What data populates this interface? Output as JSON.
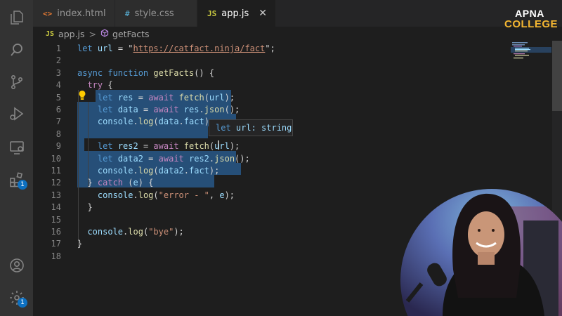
{
  "tabs": [
    {
      "icon": "<>",
      "label": "index.html",
      "active": false
    },
    {
      "icon": "#",
      "label": "style.css",
      "active": false
    },
    {
      "icon": "JS",
      "label": "app.js",
      "active": true,
      "close": "✕"
    }
  ],
  "breadcrumb": {
    "file_icon": "JS",
    "file": "app.js",
    "separator": ">",
    "symbol": "getFacts"
  },
  "activity_bar": {
    "extensions_badge": "1",
    "settings_badge": "1"
  },
  "hover": {
    "kw": "let",
    "text": " url: string"
  },
  "logo": {
    "line1": "APNA",
    "line2": "COLLEGE"
  },
  "code_lines": [
    {
      "num": "1",
      "tokens": [
        [
          "kw",
          "let"
        ],
        [
          "pl",
          " "
        ],
        [
          "var",
          "url"
        ],
        [
          "pl",
          " = \""
        ],
        [
          "url",
          "https://catfact.ninja/fact"
        ],
        [
          "pl",
          "\";"
        ]
      ]
    },
    {
      "num": "2",
      "tokens": []
    },
    {
      "num": "3",
      "tokens": [
        [
          "kw",
          "async"
        ],
        [
          "pl",
          " "
        ],
        [
          "kw",
          "function"
        ],
        [
          "pl",
          " "
        ],
        [
          "fn",
          "getFacts"
        ],
        [
          "pl",
          "() {"
        ]
      ]
    },
    {
      "num": "4",
      "tokens": [
        [
          "pl",
          "  "
        ],
        [
          "kw2",
          "try"
        ],
        [
          "pl",
          " {"
        ]
      ]
    },
    {
      "num": "5",
      "tokens": [
        [
          "pl",
          "    "
        ],
        [
          "kw",
          "let"
        ],
        [
          "pl",
          " "
        ],
        [
          "var",
          "res"
        ],
        [
          "pl",
          " = "
        ],
        [
          "kw2",
          "await"
        ],
        [
          "pl",
          " "
        ],
        [
          "fn",
          "fetch"
        ],
        [
          "pl",
          "("
        ],
        [
          "var",
          "url"
        ],
        [
          "pl",
          ");"
        ]
      ]
    },
    {
      "num": "6",
      "tokens": [
        [
          "pl",
          "    "
        ],
        [
          "kw",
          "let"
        ],
        [
          "pl",
          " "
        ],
        [
          "var",
          "data"
        ],
        [
          "pl",
          " = "
        ],
        [
          "kw2",
          "await"
        ],
        [
          "pl",
          " "
        ],
        [
          "var",
          "res"
        ],
        [
          "pl",
          "."
        ],
        [
          "fn",
          "json"
        ],
        [
          "pl",
          "();"
        ]
      ]
    },
    {
      "num": "7",
      "tokens": [
        [
          "pl",
          "    "
        ],
        [
          "var",
          "console"
        ],
        [
          "pl",
          "."
        ],
        [
          "fn",
          "log"
        ],
        [
          "pl",
          "("
        ],
        [
          "var",
          "data"
        ],
        [
          "pl",
          "."
        ],
        [
          "var",
          "fact"
        ],
        [
          "pl",
          ");"
        ]
      ]
    },
    {
      "num": "8",
      "tokens": []
    },
    {
      "num": "9",
      "tokens": [
        [
          "pl",
          "    "
        ],
        [
          "kw",
          "let"
        ],
        [
          "pl",
          " "
        ],
        [
          "var",
          "res2"
        ],
        [
          "pl",
          " = "
        ],
        [
          "kw2",
          "await"
        ],
        [
          "pl",
          " "
        ],
        [
          "fn",
          "fetch"
        ],
        [
          "pl",
          "("
        ],
        [
          "var",
          "url"
        ],
        [
          "pl",
          ");"
        ]
      ]
    },
    {
      "num": "10",
      "tokens": [
        [
          "pl",
          "    "
        ],
        [
          "kw",
          "let"
        ],
        [
          "pl",
          " "
        ],
        [
          "var",
          "data2"
        ],
        [
          "pl",
          " = "
        ],
        [
          "kw2",
          "await"
        ],
        [
          "pl",
          " "
        ],
        [
          "var",
          "res2"
        ],
        [
          "pl",
          "."
        ],
        [
          "fn",
          "json"
        ],
        [
          "pl",
          "();"
        ]
      ]
    },
    {
      "num": "11",
      "tokens": [
        [
          "pl",
          "    "
        ],
        [
          "var",
          "console"
        ],
        [
          "pl",
          "."
        ],
        [
          "fn",
          "log"
        ],
        [
          "pl",
          "("
        ],
        [
          "var",
          "data2"
        ],
        [
          "pl",
          "."
        ],
        [
          "var",
          "fact"
        ],
        [
          "pl",
          ");"
        ]
      ]
    },
    {
      "num": "12",
      "tokens": [
        [
          "pl",
          "  } "
        ],
        [
          "kw2",
          "catch"
        ],
        [
          "pl",
          " ("
        ],
        [
          "var",
          "e"
        ],
        [
          "pl",
          ") {"
        ]
      ]
    },
    {
      "num": "13",
      "tokens": [
        [
          "pl",
          "    "
        ],
        [
          "var",
          "console"
        ],
        [
          "pl",
          "."
        ],
        [
          "fn",
          "log"
        ],
        [
          "pl",
          "("
        ],
        [
          "str",
          "\"error - \""
        ],
        [
          "pl",
          ", "
        ],
        [
          "var",
          "e"
        ],
        [
          "pl",
          ");"
        ]
      ]
    },
    {
      "num": "14",
      "tokens": [
        [
          "pl",
          "  }"
        ]
      ]
    },
    {
      "num": "15",
      "tokens": []
    },
    {
      "num": "16",
      "tokens": [
        [
          "pl",
          "  "
        ],
        [
          "var",
          "console"
        ],
        [
          "pl",
          "."
        ],
        [
          "fn",
          "log"
        ],
        [
          "pl",
          "("
        ],
        [
          "str",
          "\"bye\""
        ],
        [
          "pl",
          ");"
        ]
      ]
    },
    {
      "num": "17",
      "tokens": [
        [
          "pl",
          "}"
        ]
      ]
    },
    {
      "num": "18",
      "tokens": []
    }
  ]
}
